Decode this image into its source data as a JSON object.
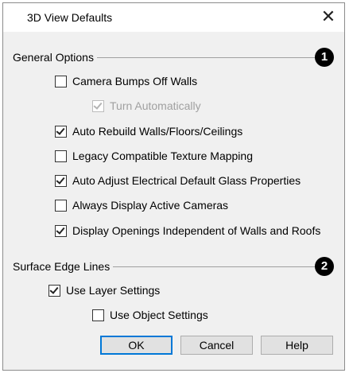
{
  "dialog": {
    "title": "3D View Defaults",
    "close_glyph": "✕"
  },
  "general_options": {
    "label": "General Options",
    "badge": "1",
    "items": [
      {
        "label": "Camera Bumps Off Walls",
        "checked": false,
        "disabled": false
      },
      {
        "label": "Turn Automatically",
        "checked": true,
        "disabled": true
      },
      {
        "label": "Auto Rebuild Walls/Floors/Ceilings",
        "checked": true,
        "disabled": false
      },
      {
        "label": "Legacy Compatible Texture Mapping",
        "checked": false,
        "disabled": false
      },
      {
        "label": "Auto Adjust Electrical Default Glass Properties",
        "checked": true,
        "disabled": false
      },
      {
        "label": "Always Display Active Cameras",
        "checked": false,
        "disabled": false
      },
      {
        "label": "Display Openings Independent of Walls and Roofs",
        "checked": true,
        "disabled": false
      }
    ]
  },
  "surface_edge_lines": {
    "label": "Surface Edge Lines",
    "badge": "2",
    "items": [
      {
        "label": "Use Layer Settings",
        "checked": true,
        "disabled": false
      },
      {
        "label": "Use Object Settings",
        "checked": false,
        "disabled": false
      }
    ]
  },
  "buttons": {
    "ok": "OK",
    "cancel": "Cancel",
    "help": "Help"
  }
}
